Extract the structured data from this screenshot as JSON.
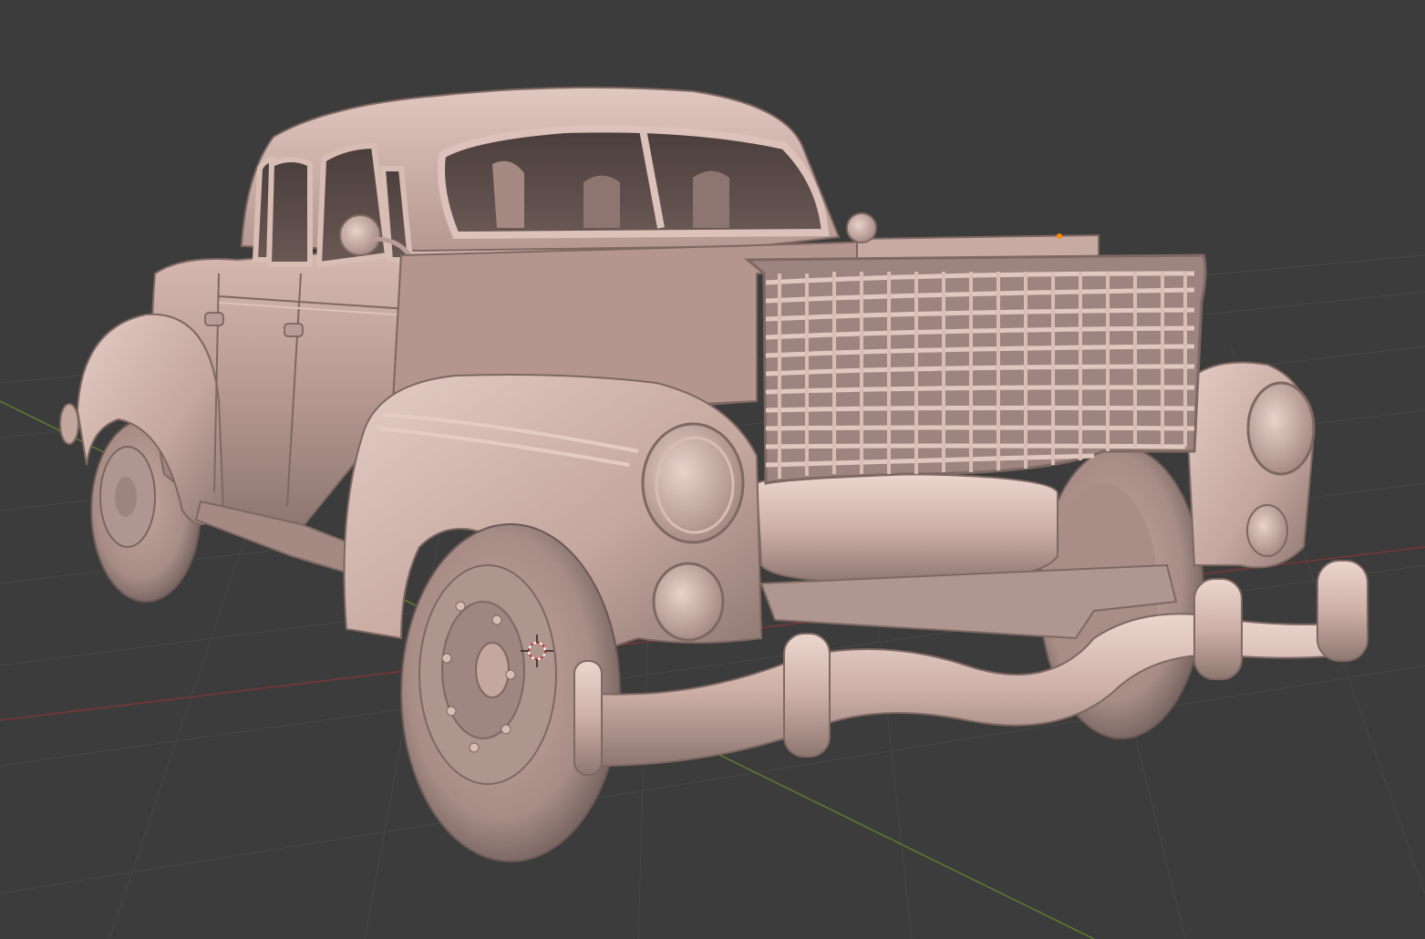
{
  "viewport": {
    "background": "#3c3c3c",
    "grid_color": "#4a4a4a",
    "x_axis_color": "#8a3a3a",
    "y_axis_color": "#6a8a2a",
    "model_color": "#c9a9a0",
    "model_shadow": "#7d6560",
    "model_highlight": "#e2cbc3",
    "origin_color": "#ff8a00",
    "cursor_color": "#c83030"
  },
  "scene": {
    "object": "vintage-car-model",
    "shading": "solid-matcap"
  }
}
